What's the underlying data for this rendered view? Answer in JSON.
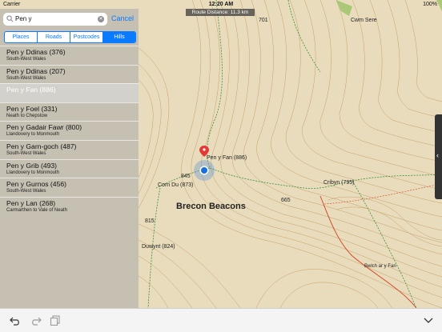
{
  "status": {
    "carrier": "Carrier",
    "time": "12:20 AM",
    "battery": "100%"
  },
  "route_distance": "Route Distance: 11.3 km",
  "search": {
    "value": "Pen y",
    "cancel": "Cancel"
  },
  "segments": [
    "Places",
    "Roads",
    "Postcodes",
    "Hills"
  ],
  "results": [
    {
      "title": "Pen y Ddinas (376)",
      "subtitle": "South-West Wales"
    },
    {
      "title": "Pen y Ddinas (207)",
      "subtitle": "South-West Wales"
    },
    {
      "title": "Pen y Fan (886)",
      "subtitle": ""
    },
    {
      "title": "Pen y Foel (331)",
      "subtitle": "Neath to Chepstow"
    },
    {
      "title": "Pen y Gadair Fawr (800)",
      "subtitle": "Llandovery to Monmouth"
    },
    {
      "title": "Pen y Garn-goch (487)",
      "subtitle": "South-West Wales"
    },
    {
      "title": "Pen y Grib (493)",
      "subtitle": "Llandovery to Monmouth"
    },
    {
      "title": "Pen y Gurnos (456)",
      "subtitle": "South-West Wales"
    },
    {
      "title": "Pen y Lan (268)",
      "subtitle": "Carmarthen to Vale of Neath"
    }
  ],
  "map_labels": {
    "cwm_sere": "Cwm Sere",
    "pen_y_fan": "Pen y Fan (886)",
    "corn_du": "Corn Du (873)",
    "brecon": "Brecon Beacons",
    "cribyn": "Cribyn (795)",
    "duwynt": "Duwynt (824)",
    "bwlch": "Bwlch ar y Fan",
    "h701": "701",
    "h845": "845",
    "h665": "665",
    "h815": "815"
  },
  "colors": {
    "accent": "#0a7aff",
    "contour": "#b88a4a",
    "path": "#3a8f3a",
    "boundary": "#d04020"
  }
}
